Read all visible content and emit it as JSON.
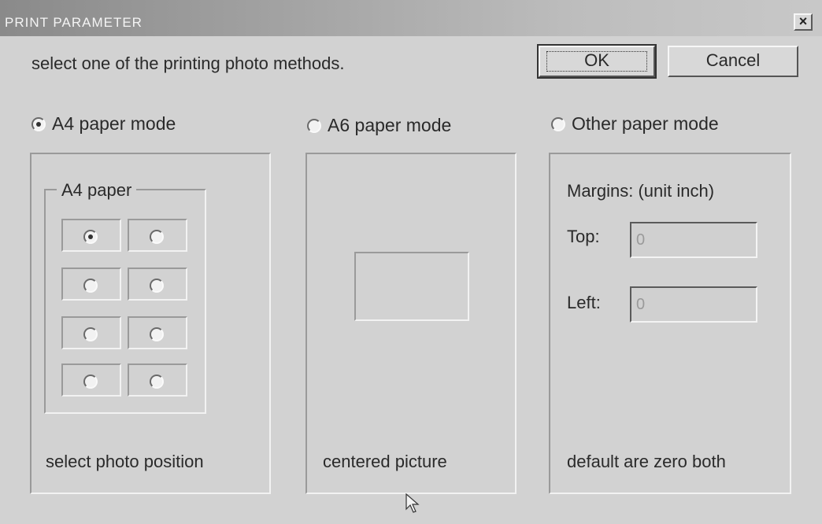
{
  "window": {
    "title": "PRINT PARAMETER",
    "close_label": "×"
  },
  "instruction": "select one of the printing photo methods.",
  "buttons": {
    "ok": "OK",
    "cancel": "Cancel"
  },
  "modes": [
    {
      "label": "A4 paper mode",
      "checked": true
    },
    {
      "label": "A6 paper mode",
      "checked": false
    },
    {
      "label": "Other paper mode",
      "checked": false
    }
  ],
  "a4_panel": {
    "group_label": "A4 paper",
    "caption": "select photo position",
    "selected_position": 1,
    "positions": 8
  },
  "a6_panel": {
    "caption": "centered picture"
  },
  "other_panel": {
    "margins_title": "Margins:  (unit inch)",
    "top_label": "Top:",
    "top_value": "0",
    "left_label": "Left:",
    "left_value": "0",
    "caption": "default are zero both"
  }
}
